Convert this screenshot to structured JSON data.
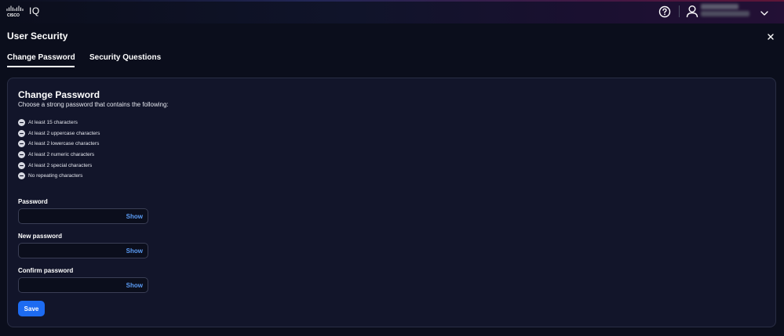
{
  "header": {
    "logo_text": "IQ",
    "brand": "CISCO",
    "icons": [
      "cisco-logo",
      "help-icon",
      "user-icon",
      "chevron-down-icon"
    ]
  },
  "page": {
    "title": "User Security",
    "close_icon": "close-icon"
  },
  "tabs": [
    {
      "label": "Change Password",
      "active": true
    },
    {
      "label": "Security Questions",
      "active": false
    }
  ],
  "card": {
    "title": "Change Password",
    "subtitle": "Choose a strong password that contains the following:",
    "requirements": [
      "At least 15 characters",
      "At least 2 uppercase characters",
      "At least 2 lowercase characters",
      "At least 2 numeric characters",
      "At least 2 special characters",
      "No repeating characters"
    ],
    "requirement_icon": "minus-circle-icon",
    "fields": [
      {
        "label": "Password",
        "value": "",
        "toggle": "Show"
      },
      {
        "label": "New password",
        "value": "",
        "toggle": "Show"
      },
      {
        "label": "Confirm password",
        "value": "",
        "toggle": "Show"
      }
    ],
    "save_label": "Save"
  },
  "colors": {
    "background": "#0b0e1c",
    "card": "#12152a",
    "accent": "#1d6bf1",
    "link": "#5b9cf5"
  }
}
